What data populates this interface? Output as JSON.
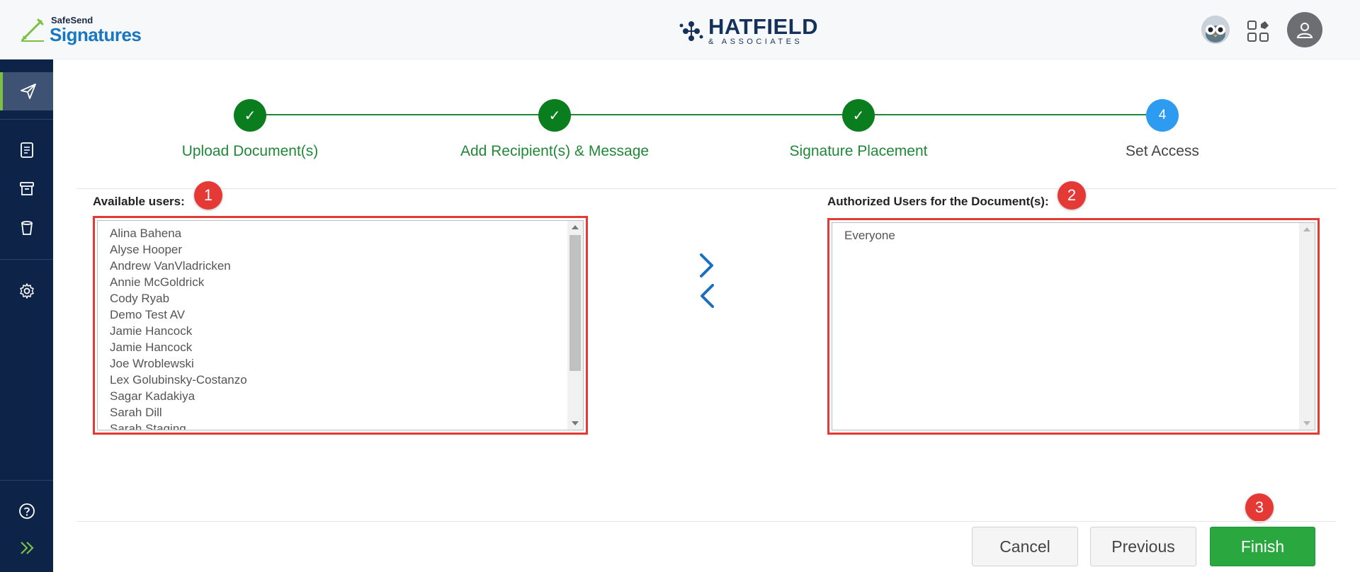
{
  "header": {
    "brand_small": "SafeSend",
    "brand_big": "Signatures",
    "firm_name": "HATFIELD",
    "firm_sub": "& ASSOCIATES"
  },
  "sidebar": {
    "items": [
      {
        "icon": "send-icon",
        "active": true
      },
      {
        "icon": "document-icon"
      },
      {
        "icon": "archive-icon"
      },
      {
        "icon": "recycle-bin-icon"
      },
      {
        "icon": "gear-icon"
      },
      {
        "icon": "help-icon"
      },
      {
        "icon": "expand-chevrons-icon"
      }
    ]
  },
  "stepper": {
    "steps": [
      {
        "label": "Upload Document(s)",
        "status": "done",
        "mark": "✓"
      },
      {
        "label": "Add Recipient(s) & Message",
        "status": "done",
        "mark": "✓"
      },
      {
        "label": "Signature Placement",
        "status": "done",
        "mark": "✓"
      },
      {
        "label": "Set Access",
        "status": "current",
        "mark": "4"
      }
    ]
  },
  "available": {
    "label": "Available users:",
    "users": [
      "Alina Bahena",
      "Alyse Hooper",
      "Andrew VanVladricken",
      "Annie McGoldrick",
      "Cody Ryab",
      "Demo Test AV",
      "Jamie Hancock",
      "Jamie Hancock",
      "Joe Wroblewski",
      "Lex Golubinsky-Costanzo",
      "Sagar Kadakiya",
      "Sarah Dill",
      "Sarah Staging"
    ]
  },
  "authorized": {
    "label": "Authorized Users for the Document(s):",
    "users": [
      "Everyone"
    ]
  },
  "badges": {
    "one": "1",
    "two": "2",
    "three": "3"
  },
  "buttons": {
    "cancel": "Cancel",
    "previous": "Previous",
    "finish": "Finish"
  },
  "colors": {
    "sidebar_bg": "#0d2448",
    "step_done": "#0a7d1f",
    "step_current": "#2d9cf0",
    "primary_button": "#2aa83f",
    "annotation_red": "#e53935",
    "brand_blue": "#1777c2"
  }
}
